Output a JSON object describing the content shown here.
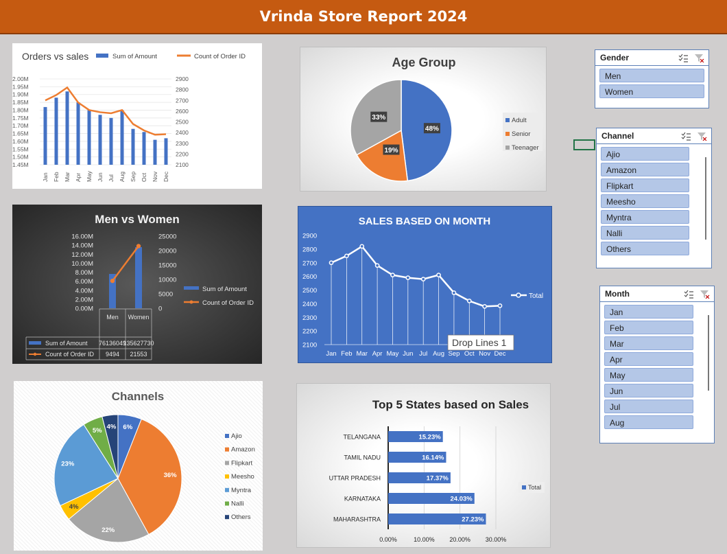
{
  "header": {
    "title": "Vrinda Store Report 2024"
  },
  "colors": {
    "blue": "#4472c4",
    "orange": "#ed7d31",
    "gray": "#a5a5a5",
    "yellow": "#ffc000",
    "lightblue": "#5b9bd5",
    "green": "#70ad47",
    "navy": "#264478",
    "header": "#c55a11"
  },
  "charts": {
    "orders_vs_sales": {
      "title": "Orders vs sales",
      "legend": [
        "Sum of Amount",
        "Count of Order ID"
      ],
      "left_ticks": [
        "2.00M",
        "1.95M",
        "1.90M",
        "1.85M",
        "1.80M",
        "1.75M",
        "1.70M",
        "1.65M",
        "1.60M",
        "1.55M",
        "1.50M",
        "1.45M"
      ],
      "right_ticks": [
        "2900",
        "2800",
        "2700",
        "2600",
        "2500",
        "2400",
        "2300",
        "2200",
        "2100"
      ]
    },
    "age_group": {
      "title": "Age Group",
      "legend": [
        "Adult",
        "Senior",
        "Teenager"
      ],
      "labels": [
        "48%",
        "19%",
        "33%"
      ]
    },
    "men_vs_women": {
      "title": "Men vs Women",
      "left_ticks": [
        "16.00M",
        "14.00M",
        "12.00M",
        "10.00M",
        "8.00M",
        "6.00M",
        "4.00M",
        "2.00M",
        "0.00M"
      ],
      "right_ticks": [
        "25000",
        "20000",
        "15000",
        "10000",
        "5000",
        "0"
      ],
      "legend": [
        "Sum of Amount",
        "Count of Order ID"
      ],
      "table_cols": [
        "Men",
        "Women"
      ],
      "table_rows": [
        {
          "label": "Sum of Amount",
          "values": [
            "76136049",
            "135627730"
          ]
        },
        {
          "label": "Count of Order ID",
          "values": [
            "9494",
            "21553"
          ]
        }
      ]
    },
    "sales_month": {
      "title": "SALES BASED ON MONTH",
      "legend": "Total",
      "tooltip": "Drop Lines 1",
      "ticks": [
        "2900",
        "2800",
        "2700",
        "2600",
        "2500",
        "2400",
        "2300",
        "2200",
        "2100"
      ]
    },
    "channels": {
      "title": "Channels",
      "legend": [
        "Ajio",
        "Amazon",
        "Flipkart",
        "Meesho",
        "Myntra",
        "Nalli",
        "Others"
      ],
      "labels": [
        "6%",
        "36%",
        "22%",
        "4%",
        "23%",
        "5%",
        "4%"
      ]
    },
    "top_states": {
      "title": "Top 5 States based on Sales",
      "legend": "Total",
      "states": [
        "TELANGANA",
        "TAMIL NADU",
        "UTTAR PRADESH",
        "KARNATAKA",
        "MAHARASHTRA"
      ],
      "labels": [
        "15.23%",
        "16.14%",
        "17.37%",
        "24.03%",
        "27.23%"
      ],
      "ticks": [
        "0.00%",
        "10.00%",
        "20.00%",
        "30.00%"
      ]
    }
  },
  "chart_data": [
    {
      "type": "bar",
      "title": "Orders vs sales",
      "categories": [
        "Jan",
        "Feb",
        "Mar",
        "Apr",
        "May",
        "Jun",
        "Jul",
        "Aug",
        "Sep",
        "Oct",
        "Nov",
        "Dec"
      ],
      "series": [
        {
          "name": "Sum of Amount",
          "values": [
            1.82,
            1.88,
            1.92,
            1.85,
            1.8,
            1.77,
            1.75,
            1.8,
            1.68,
            1.66,
            1.61,
            1.62
          ]
        },
        {
          "name": "Count of Order ID",
          "values": [
            2700,
            2750,
            2820,
            2680,
            2610,
            2590,
            2580,
            2610,
            2480,
            2420,
            2380,
            2385
          ]
        }
      ],
      "ylim": [
        1.45,
        2.0
      ],
      "y2lim": [
        2100,
        2900
      ]
    },
    {
      "type": "pie",
      "title": "Age Group",
      "categories": [
        "Adult",
        "Senior",
        "Teenager"
      ],
      "values": [
        48,
        19,
        33
      ]
    },
    {
      "type": "bar",
      "title": "Men vs Women",
      "categories": [
        "Men",
        "Women"
      ],
      "series": [
        {
          "name": "Sum of Amount",
          "values": [
            7.6136049,
            13.562773
          ]
        },
        {
          "name": "Count of Order ID",
          "values": [
            9494,
            21553
          ]
        }
      ],
      "ylim": [
        0,
        16
      ],
      "y2lim": [
        0,
        25000
      ]
    },
    {
      "type": "line",
      "title": "SALES BASED ON MONTH",
      "categories": [
        "Jan",
        "Feb",
        "Mar",
        "Apr",
        "May",
        "Jun",
        "Jul",
        "Aug",
        "Sep",
        "Oct",
        "Nov",
        "Dec"
      ],
      "series": [
        {
          "name": "Total",
          "values": [
            2700,
            2750,
            2820,
            2680,
            2610,
            2590,
            2580,
            2610,
            2480,
            2420,
            2380,
            2385
          ]
        }
      ],
      "ylim": [
        2100,
        2900
      ]
    },
    {
      "type": "pie",
      "title": "Channels",
      "categories": [
        "Ajio",
        "Amazon",
        "Flipkart",
        "Meesho",
        "Myntra",
        "Nalli",
        "Others"
      ],
      "values": [
        6,
        36,
        22,
        4,
        23,
        5,
        4
      ]
    },
    {
      "type": "bar",
      "title": "Top 5 States based on Sales",
      "categories": [
        "TELANGANA",
        "TAMIL NADU",
        "UTTAR PRADESH",
        "KARNATAKA",
        "MAHARASHTRA"
      ],
      "series": [
        {
          "name": "Total",
          "values": [
            15.23,
            16.14,
            17.37,
            24.03,
            27.23
          ]
        }
      ],
      "xlim": [
        0,
        30
      ]
    }
  ],
  "slicers": {
    "gender": {
      "title": "Gender",
      "items": [
        "Men",
        "Women"
      ]
    },
    "channel": {
      "title": "Channel",
      "items": [
        "Ajio",
        "Amazon",
        "Flipkart",
        "Meesho",
        "Myntra",
        "Nalli",
        "Others"
      ]
    },
    "month": {
      "title": "Month",
      "items": [
        "Jan",
        "Feb",
        "Mar",
        "Apr",
        "May",
        "Jun",
        "Jul",
        "Aug"
      ]
    }
  }
}
